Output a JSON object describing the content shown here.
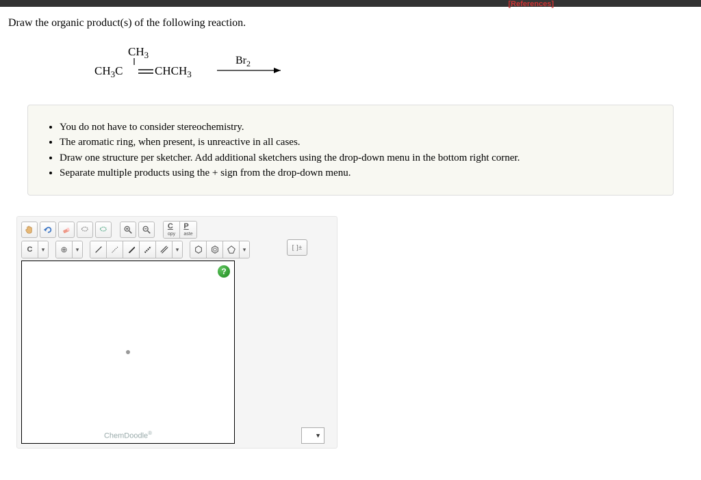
{
  "header": {
    "references_label": "[References]"
  },
  "question": {
    "prompt": "Draw the organic product(s) of the following reaction.",
    "reaction": {
      "reactant_line1": "CH",
      "reactant_line1_sub": "3",
      "reactant_line2_left": "CH",
      "reactant_line2_left_sub": "3",
      "reactant_line2_c": "C",
      "reactant_line2_eq": "═",
      "reactant_line2_right1": "CHCH",
      "reactant_line2_right1_sub": "3",
      "reagent": "Br",
      "reagent_sub": "2"
    }
  },
  "instructions": {
    "items": [
      "You do not have to consider stereochemistry.",
      "The aromatic ring, when present, is unreactive in all cases.",
      "Draw one structure per sketcher. Add additional sketchers using the drop-down menu in the bottom right corner.",
      "Separate multiple products using the + sign from the drop-down menu."
    ]
  },
  "sketcher": {
    "toolbar1": {
      "hand": "hand",
      "undo": "undo",
      "eraser": "eraser",
      "redo1": "lasso",
      "redo2": "lasso2",
      "zoom_in": "zoom-in",
      "zoom_out": "zoom-out",
      "copy": "C",
      "copy_sub": "opy",
      "paste": "P",
      "paste_sub": "aste"
    },
    "toolbar2": {
      "element": "C",
      "charge": "⊕",
      "bonds": [
        "bond-single",
        "bond-wedge",
        "bond-bold",
        "bond-dash",
        "bond-double"
      ],
      "rings": [
        "cyclohexane",
        "benzene",
        "cyclopentane"
      ],
      "bracket": "[ ]±"
    },
    "help": "?",
    "brand": "ChemDoodle",
    "brand_mark": "®",
    "dropdown": "▼"
  }
}
